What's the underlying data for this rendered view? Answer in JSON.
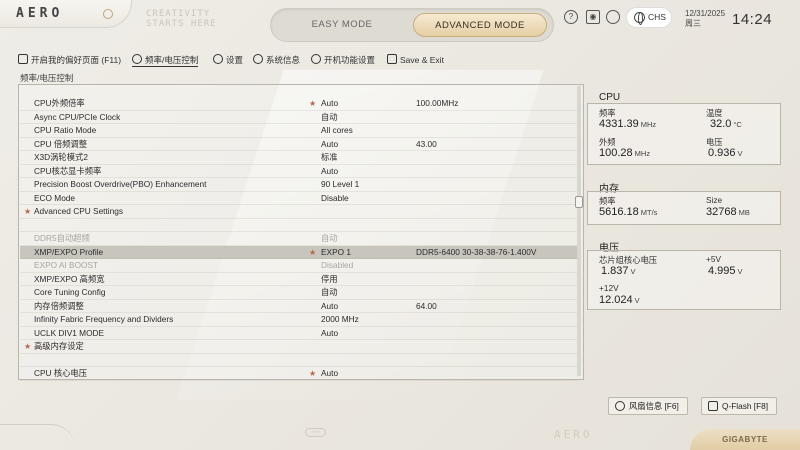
{
  "header": {
    "logo": "AERO",
    "tagline_line1": "CREATIVITY",
    "tagline_line2": "STARTS HERE",
    "easy_mode": "EASY MODE",
    "advanced_mode": "ADVANCED MODE",
    "language": "CHS",
    "date": "12/31/2025",
    "weekday": "周三",
    "time": "14:24"
  },
  "nav": {
    "favorites": "开启我的偏好页面 (F11)",
    "frequency": "频率/电压控制",
    "settings": "设置",
    "sysinfo": "系统信息",
    "boot": "开机功能设置",
    "save_exit": "Save & Exit"
  },
  "breadcrumb": "频率/电压控制",
  "rows": [
    {
      "name": "CPU外频倍率",
      "star": "★",
      "value": "Auto",
      "extra": "100.00MHz"
    },
    {
      "name": "Async CPU/PCIe Clock",
      "star": "",
      "value": "自动",
      "extra": ""
    },
    {
      "name": "CPU Ratio Mode",
      "star": "",
      "value": "All cores",
      "extra": ""
    },
    {
      "name": "CPU 倍频调整",
      "star": "",
      "value": "Auto",
      "extra": "43.00"
    },
    {
      "name": "X3D涡轮模式2",
      "star": "",
      "value": "标准",
      "extra": ""
    },
    {
      "name": "CPU核芯显卡频率",
      "star": "",
      "value": "Auto",
      "extra": ""
    },
    {
      "name": "Precision Boost Overdrive(PBO) Enhancement",
      "star": "",
      "value": "90 Level 1",
      "extra": ""
    },
    {
      "name": "ECO Mode",
      "star": "",
      "value": "Disable",
      "extra": ""
    },
    {
      "name": "Advanced CPU Settings",
      "star": "",
      "value": "",
      "extra": "",
      "bullet": "★"
    },
    {
      "name": "",
      "star": "",
      "value": "",
      "extra": ""
    },
    {
      "name": "DDR5自动超频",
      "star": "",
      "value": "自动",
      "extra": "",
      "dim": true
    },
    {
      "name": "XMP/EXPO Profile",
      "star": "★",
      "value": "EXPO 1",
      "extra": "DDR5-6400 30-38-38-76-1.400V",
      "selected": true
    },
    {
      "name": "EXPO AI BOOST",
      "star": "",
      "value": "Disabled",
      "extra": "",
      "dim": true
    },
    {
      "name": "XMP/EXPO 高频宽",
      "star": "",
      "value": "停用",
      "extra": ""
    },
    {
      "name": "Core Tuning Config",
      "star": "",
      "value": "自动",
      "extra": ""
    },
    {
      "name": "内存倍频调整",
      "star": "",
      "value": "Auto",
      "extra": "64.00"
    },
    {
      "name": "Infinity Fabric Frequency and Dividers",
      "star": "",
      "value": "2000 MHz",
      "extra": ""
    },
    {
      "name": "UCLK DIV1 MODE",
      "star": "",
      "value": "Auto",
      "extra": ""
    },
    {
      "name": "高级内存设定",
      "star": "",
      "value": "",
      "extra": "",
      "bullet": "★"
    },
    {
      "name": "",
      "star": "",
      "value": "",
      "extra": ""
    },
    {
      "name": "CPU 核心电压",
      "star": "★",
      "value": "Auto",
      "extra": ""
    }
  ],
  "info": {
    "cpu": {
      "title": "CPU",
      "freq_label": "频率",
      "freq_value": "4331.39",
      "freq_unit": "MHz",
      "temp_label": "温度",
      "temp_value": "32.0",
      "temp_unit": "°C",
      "bclk_label": "外频",
      "bclk_value": "100.28",
      "bclk_unit": "MHz",
      "volt_label": "电压",
      "volt_value": "0.936",
      "volt_unit": "V"
    },
    "memory": {
      "title": "内存",
      "freq_label": "频率",
      "freq_value": "5616.18",
      "freq_unit": "MT/s",
      "size_label": "Size",
      "size_value": "32768",
      "size_unit": "MB"
    },
    "voltage": {
      "title": "电压",
      "chipset_label": "芯片组核心电压",
      "chipset_value": "1.837",
      "chipset_unit": "V",
      "p5v_label": "+5V",
      "p5v_value": "4.995",
      "p5v_unit": "V",
      "p12v_label": "+12V",
      "p12v_value": "12.024",
      "p12v_unit": "V"
    }
  },
  "bottom": {
    "fan_info": "风扇信息 [F6]",
    "qflash": "Q-Flash [F8]",
    "footer_dots": "◦◦◦",
    "footer_logo": "AERO",
    "brand": "GIGABYTE"
  },
  "colors": {
    "accent": "#e5cfa5",
    "star": "#b9664e",
    "selected_row": "#c8c5bd"
  }
}
